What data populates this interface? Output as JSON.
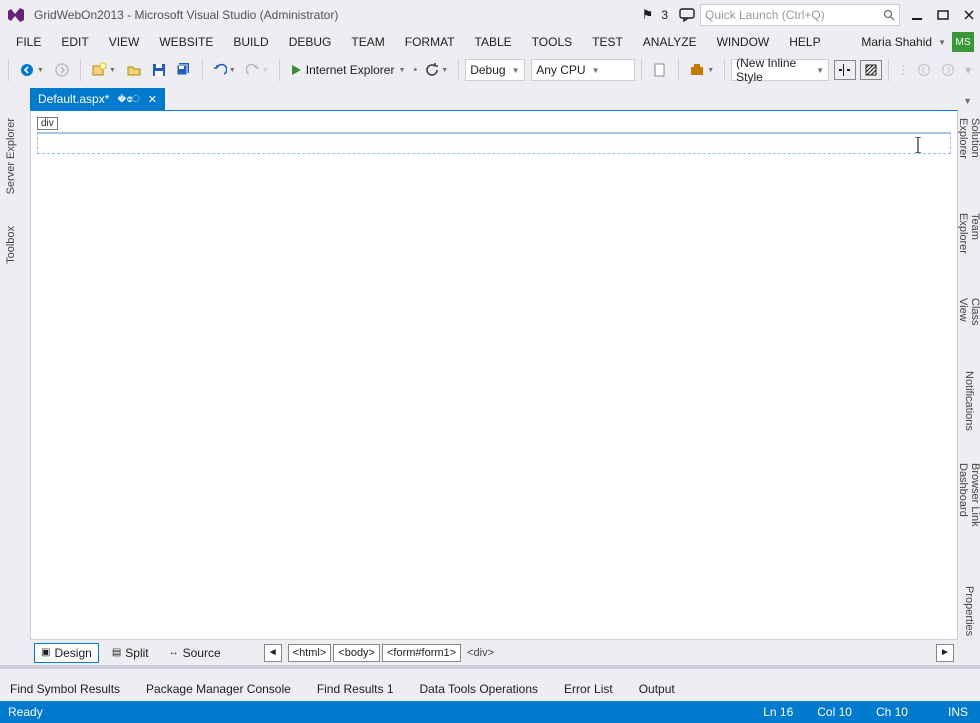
{
  "title": "GridWebOn2013 - Microsoft Visual Studio (Administrator)",
  "notif_count": "3",
  "search_placeholder": "Quick Launch (Ctrl+Q)",
  "menu": [
    "FILE",
    "EDIT",
    "VIEW",
    "WEBSITE",
    "BUILD",
    "DEBUG",
    "TEAM",
    "FORMAT",
    "TABLE",
    "TOOLS",
    "TEST",
    "ANALYZE",
    "WINDOW",
    "HELP"
  ],
  "user_name": "Maria Shahid",
  "user_badge": "MS",
  "toolbar": {
    "run_target": "Internet Explorer",
    "config": "Debug",
    "platform": "Any CPU",
    "style_combo": "(New Inline Style"
  },
  "tab": {
    "label": "Default.aspx*"
  },
  "left_tabs": [
    "Server Explorer",
    "Toolbox"
  ],
  "right_tabs": [
    "Solution Explorer",
    "Team Explorer",
    "Class View",
    "Notifications",
    "Browser Link Dashboard",
    "Properties"
  ],
  "tagchip": "div",
  "viewbar": {
    "design": "Design",
    "split": "Split",
    "source": "Source",
    "crumbs": [
      "<html>",
      "<body>",
      "<form#form1>"
    ],
    "crumb_plain": "<div>"
  },
  "bottom_tabs": [
    "Find Symbol Results",
    "Package Manager Console",
    "Find Results 1",
    "Data Tools Operations",
    "Error List",
    "Output"
  ],
  "status": {
    "ready": "Ready",
    "ln": "Ln 16",
    "col": "Col 10",
    "ch": "Ch 10",
    "ins": "INS"
  }
}
